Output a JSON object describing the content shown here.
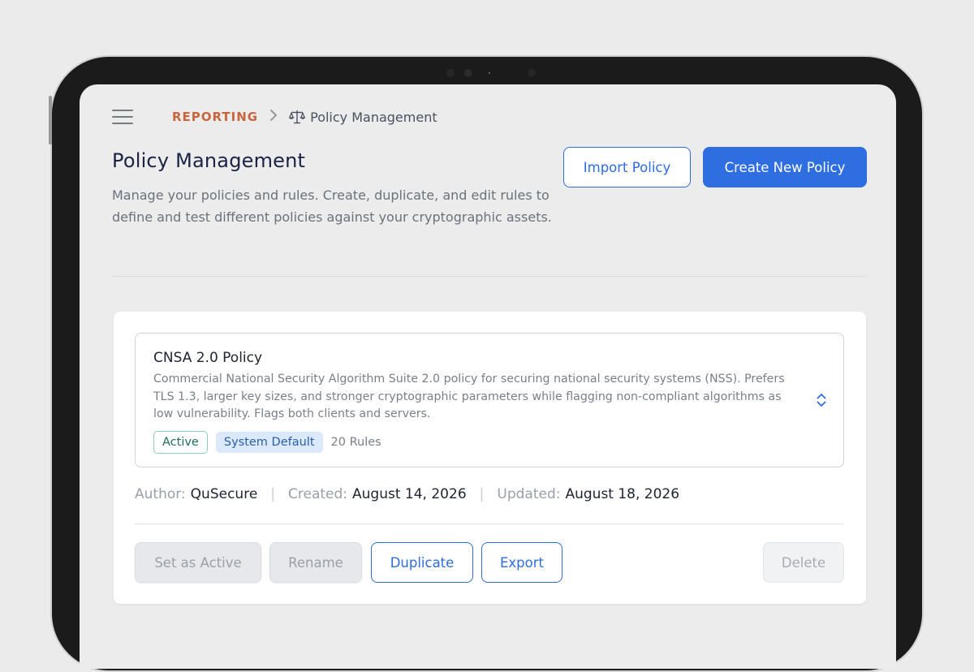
{
  "breadcrumb": {
    "section": "REPORTING",
    "current": "Policy Management"
  },
  "header": {
    "title": "Policy Management",
    "description": "Manage your policies and rules. Create, duplicate, and edit rules to define and test different policies against your cryptographic assets.",
    "import_label": "Import Policy",
    "create_label": "Create New Policy"
  },
  "policy": {
    "name": "CNSA 2.0 Policy",
    "description": "Commercial National Security Algorithm Suite 2.0 policy for securing national security systems (NSS). Prefers TLS 1.3, larger key sizes, and stronger cryptographic parameters while flagging non-compliant algorithms as low vulnerability. Flags both clients and servers.",
    "status_tag": "Active",
    "default_tag": "System Default",
    "rules_count": "20 Rules",
    "author_label": "Author:",
    "author": "QuSecure",
    "created_label": "Created:",
    "created": "August 14, 2026",
    "updated_label": "Updated:",
    "updated": "August 18, 2026"
  },
  "actions": {
    "set_active": "Set as Active",
    "rename": "Rename",
    "duplicate": "Duplicate",
    "export": "Export",
    "delete": "Delete"
  },
  "colors": {
    "accent": "#2e6ee0",
    "breadcrumb_section": "#c7663e",
    "active_tag": "#1f6e58",
    "default_tag_bg": "#dce9fb"
  },
  "icons": {
    "menu": "hamburger-menu-icon",
    "breadcrumb_sep": "chevron-right-icon",
    "page": "scale-icon",
    "expand": "chevron-up-down-icon"
  }
}
